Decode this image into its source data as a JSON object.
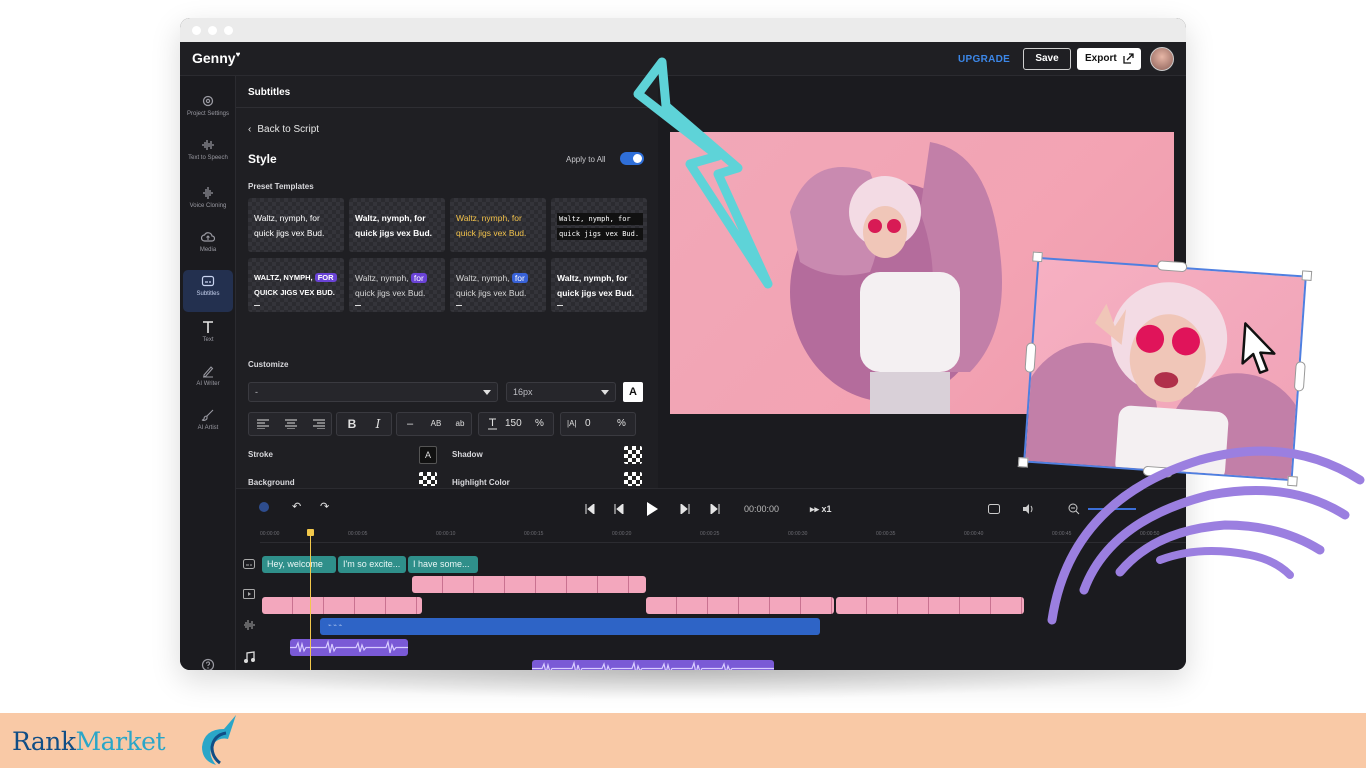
{
  "app": {
    "name": "Genny"
  },
  "topbar": {
    "upgrade": "UPGRADE",
    "save": "Save",
    "export": "Export"
  },
  "nav": [
    {
      "label": "Project Settings",
      "icon": "gear-icon"
    },
    {
      "label": "Text to Speech",
      "icon": "waveform-icon"
    },
    {
      "label": "Voice Cloning",
      "icon": "voice-clone-icon"
    },
    {
      "label": "Media",
      "icon": "cloud-upload-icon"
    },
    {
      "label": "Subtitles",
      "icon": "subtitles-icon"
    },
    {
      "label": "Text",
      "icon": "text-icon"
    },
    {
      "label": "AI Writer",
      "icon": "pen-icon"
    },
    {
      "label": "AI Artist",
      "icon": "brush-icon"
    }
  ],
  "panel": {
    "title": "Subtitles",
    "back": "Back to Script",
    "style": "Style",
    "apply_all": "Apply to All",
    "apply_all_on": true,
    "preset_label": "Preset Templates",
    "templates": [
      {
        "l1": "Waltz, nymph, for",
        "l2": "quick jigs vex Bud."
      },
      {
        "l1": "Waltz, nymph, for",
        "l2": "quick jigs vex Bud."
      },
      {
        "l1": "Waltz, nymph, for",
        "l2": "quick jigs vex Bud."
      },
      {
        "l1": "Waltz, nymph, for",
        "l2": "quick jigs vex Bud."
      },
      {
        "l1": "WALTZ, NYMPH,",
        "hl": "FOR",
        "l2": "QUICK JIGS VEX BUD."
      },
      {
        "l1": "Waltz, nymph,",
        "hl": "for",
        "l2": "quick jigs vex Bud."
      },
      {
        "l1": "Waltz, nymph,",
        "hl": "for",
        "l2": "quick jigs vex Bud."
      },
      {
        "l1": "Waltz, nymph, for",
        "l2": "quick jigs vex Bud."
      }
    ],
    "customize": "Customize",
    "font_value": "-",
    "size_value": "16px",
    "font_box": "A",
    "bold": "B",
    "italic": "I",
    "case_dash": "–",
    "case_upper": "AB",
    "case_lower": "ab",
    "line_height": "150",
    "letter_spacing": "0",
    "percent": "%",
    "stroke": "Stroke",
    "shadow": "Shadow",
    "background": "Background",
    "highlight": "Highlight Color",
    "stroke_swatch": "A"
  },
  "timeline": {
    "timecode": "00:00:00",
    "speed": "x1",
    "ticks": [
      "00:00:00",
      "00:00:05",
      "00:00:10",
      "00:00:15",
      "00:00:20",
      "00:00:25",
      "00:00:30",
      "00:00:35",
      "00:00:40",
      "00:00:45",
      "00:00:50"
    ],
    "subtitles": [
      "Hey, welcome",
      "I'm so excite...",
      "I have some..."
    ]
  },
  "footer": {
    "brand1": "Rank",
    "brand2": "Market"
  },
  "colors": {
    "accent": "#2f6fd8",
    "teal_bolt": "#5ed3d8",
    "purple_arcs": "#9b7fe0",
    "footer": "#f9c9a6"
  }
}
